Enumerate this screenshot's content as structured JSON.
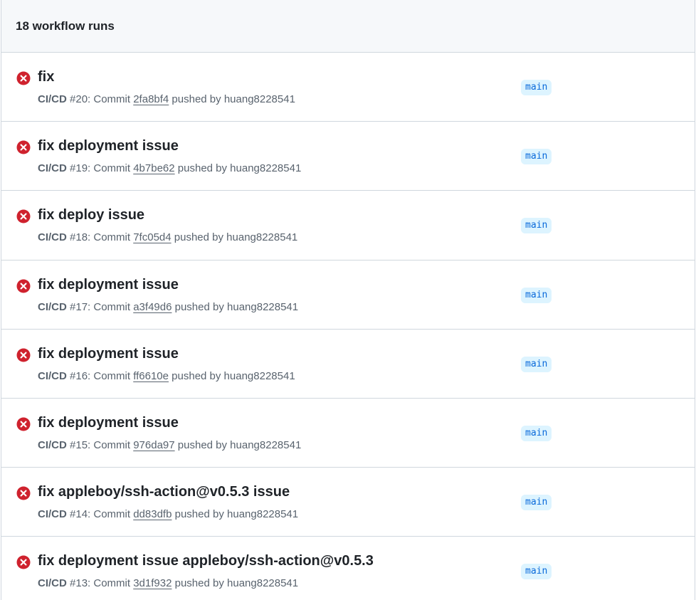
{
  "header": {
    "title": "18 workflow runs"
  },
  "colors": {
    "failure": "#cf222e",
    "branch_bg": "#ddf4ff",
    "branch_fg": "#0969da"
  },
  "runs": [
    {
      "status_icon": "x-circle-fill-icon",
      "title": "fix",
      "workflow": "CI/CD",
      "number_text": " #20: Commit ",
      "sha": "2fa8bf4",
      "pushed_by": " pushed by huang8228541",
      "branch": "main"
    },
    {
      "status_icon": "x-circle-fill-icon",
      "title": "fix deployment issue",
      "workflow": "CI/CD",
      "number_text": " #19: Commit ",
      "sha": "4b7be62",
      "pushed_by": " pushed by huang8228541",
      "branch": "main"
    },
    {
      "status_icon": "x-circle-fill-icon",
      "title": "fix deploy issue",
      "workflow": "CI/CD",
      "number_text": " #18: Commit ",
      "sha": "7fc05d4",
      "pushed_by": " pushed by huang8228541",
      "branch": "main"
    },
    {
      "status_icon": "x-circle-fill-icon",
      "title": "fix deployment issue",
      "workflow": "CI/CD",
      "number_text": " #17: Commit ",
      "sha": "a3f49d6",
      "pushed_by": " pushed by huang8228541",
      "branch": "main"
    },
    {
      "status_icon": "x-circle-fill-icon",
      "title": "fix deployment issue",
      "workflow": "CI/CD",
      "number_text": " #16: Commit ",
      "sha": "ff6610e",
      "pushed_by": " pushed by huang8228541",
      "branch": "main"
    },
    {
      "status_icon": "x-circle-fill-icon",
      "title": "fix deployment issue",
      "workflow": "CI/CD",
      "number_text": " #15: Commit ",
      "sha": "976da97",
      "pushed_by": " pushed by huang8228541",
      "branch": "main"
    },
    {
      "status_icon": "x-circle-fill-icon",
      "title": "fix appleboy/ssh-action@v0.5.3 issue",
      "workflow": "CI/CD",
      "number_text": " #14: Commit ",
      "sha": "dd83dfb",
      "pushed_by": " pushed by huang8228541",
      "branch": "main"
    },
    {
      "status_icon": "x-circle-fill-icon",
      "title": "fix deployment issue appleboy/ssh-action@v0.5.3",
      "workflow": "CI/CD",
      "number_text": " #13: Commit ",
      "sha": "3d1f932",
      "pushed_by": " pushed by huang8228541",
      "branch": "main"
    }
  ]
}
